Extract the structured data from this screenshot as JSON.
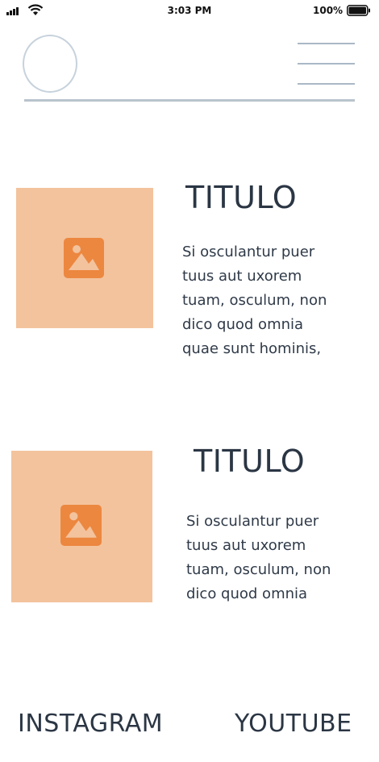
{
  "status_bar": {
    "time": "3:03 PM",
    "battery": "100%"
  },
  "cards": [
    {
      "title": "TITULO",
      "text_lines": [
        "Si osculantur puer",
        "tuus aut uxorem",
        "tuam, osculum, non",
        "dico quod omnia",
        "quae sunt hominis,"
      ]
    },
    {
      "title": "TITULO",
      "text_lines": [
        "Si osculantur puer",
        "tuus aut uxorem",
        "tuam, osculum, non",
        "dico quod omnia"
      ]
    }
  ],
  "footer": {
    "instagram": "INSTAGRAM",
    "youtube": "YOUTUBE"
  },
  "icons": {
    "image": "image-placeholder-icon",
    "menu": "hamburger-menu-icon"
  },
  "colors": {
    "placeholder_bg": "#f3c39d",
    "placeholder_icon": "#ec8740",
    "header_line": "#b8c3cd"
  }
}
